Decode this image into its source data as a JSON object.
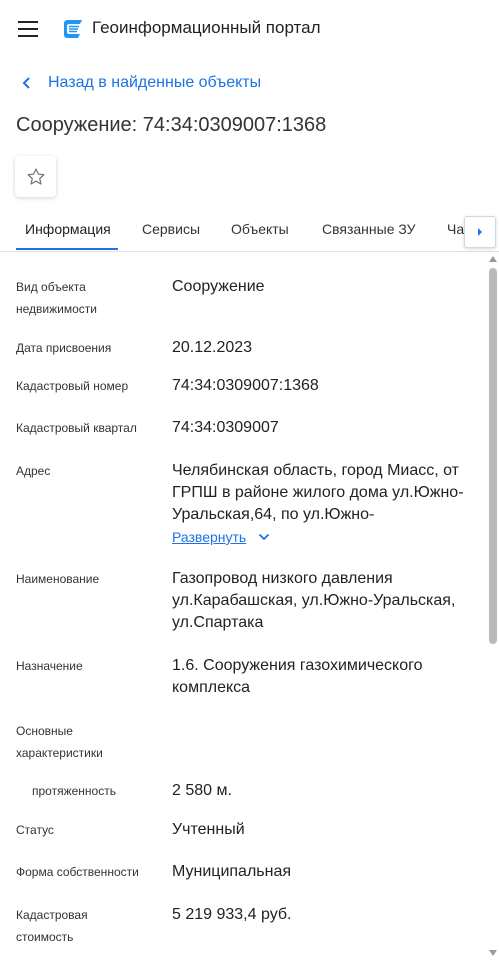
{
  "header": {
    "title": "Геоинформационный портал"
  },
  "back_link": "Назад в найденные объекты",
  "page_title": "Сооружение: 74:34:0309007:1368",
  "tabs": [
    {
      "label": "Информация"
    },
    {
      "label": "Сервисы"
    },
    {
      "label": "Объекты"
    },
    {
      "label": "Связанные ЗУ"
    },
    {
      "label": "Ча"
    }
  ],
  "fields": {
    "kind_label": "Вид объекта недвижимости",
    "kind_value": "Сооружение",
    "date_label": "Дата присвоения",
    "date_value": "20.12.2023",
    "cadnum_label": "Кадастровый номер",
    "cadnum_value": "74:34:0309007:1368",
    "quarter_label": "Кадастровый квартал",
    "quarter_value": "74:34:0309007",
    "address_label": "Адрес",
    "address_value": "Челябинская область, город Миасс, от ГРПШ в районе жилого дома ул.Южно-Уральская,64, по ул.Южно-",
    "address_expand": "Развернуть",
    "name_label": "Наименование",
    "name_value": "Газопровод низкого давления ул.Карабашская, ул.Южно-Уральская, ул.Спартака",
    "purpose_label": "Назначение",
    "purpose_value": "1.6. Сооружения газохимического комплекса",
    "main_char_label": "Основные характеристики",
    "length_label": "протяженность",
    "length_value": "2 580 м.",
    "status_label": "Статус",
    "status_value": "Учтенный",
    "ownership_label": "Форма собственности",
    "ownership_value": "Муниципальная",
    "cost_label": "Кадастровая стоимость",
    "cost_value": "5 219 933,4 руб."
  },
  "colors": {
    "accent": "#1a73e8",
    "logo": "#2196f3"
  },
  "icons": [
    "menu-icon",
    "portal-logo-icon",
    "chevron-left-icon",
    "star-icon",
    "chevron-right-icon",
    "chevron-down-icon"
  ]
}
